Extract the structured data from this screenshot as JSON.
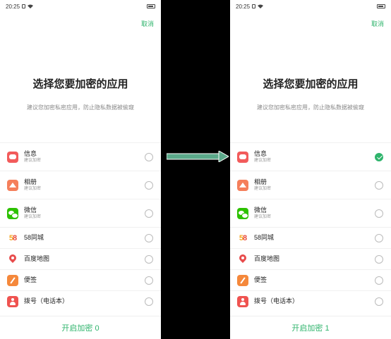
{
  "screens": {
    "left": {
      "status_time": "20:25",
      "cancel_label": "取消",
      "title": "选择您要加密的应用",
      "subtitle": "建议您加密私密应用，防止隐私数据被偷窥",
      "apps": [
        {
          "name": "信息",
          "sub": "建议加密",
          "icon": "messages-icon",
          "checked": false
        },
        {
          "name": "相册",
          "sub": "建议加密",
          "icon": "gallery-icon",
          "checked": false
        },
        {
          "name": "微信",
          "sub": "建议加密",
          "icon": "wechat-icon",
          "checked": false
        },
        {
          "name": "58同城",
          "sub": "",
          "icon": "58tongcheng-icon",
          "checked": false
        },
        {
          "name": "百度地图",
          "sub": "",
          "icon": "baidu-map-icon",
          "checked": false
        },
        {
          "name": "便签",
          "sub": "",
          "icon": "notes-icon",
          "checked": false
        },
        {
          "name": "拨号（电话本）",
          "sub": "",
          "icon": "dialer-icon",
          "checked": false
        }
      ],
      "enable_label": "开启加密 0"
    },
    "right": {
      "status_time": "20:25",
      "cancel_label": "取消",
      "title": "选择您要加密的应用",
      "subtitle": "建议您加密私密应用，防止隐私数据被偷窥",
      "apps": [
        {
          "name": "信息",
          "sub": "建议加密",
          "icon": "messages-icon",
          "checked": true
        },
        {
          "name": "相册",
          "sub": "建议加密",
          "icon": "gallery-icon",
          "checked": false
        },
        {
          "name": "微信",
          "sub": "建议加密",
          "icon": "wechat-icon",
          "checked": false
        },
        {
          "name": "58同城",
          "sub": "",
          "icon": "58tongcheng-icon",
          "checked": false
        },
        {
          "name": "百度地图",
          "sub": "",
          "icon": "baidu-map-icon",
          "checked": false
        },
        {
          "name": "便签",
          "sub": "",
          "icon": "notes-icon",
          "checked": false
        },
        {
          "name": "拨号（电话本）",
          "sub": "",
          "icon": "dialer-icon",
          "checked": false
        }
      ],
      "enable_label": "开启加密 1"
    }
  },
  "colors": {
    "accent": "#2fb46c",
    "arrow": "#5ba98a",
    "divider_background": "#000000"
  }
}
